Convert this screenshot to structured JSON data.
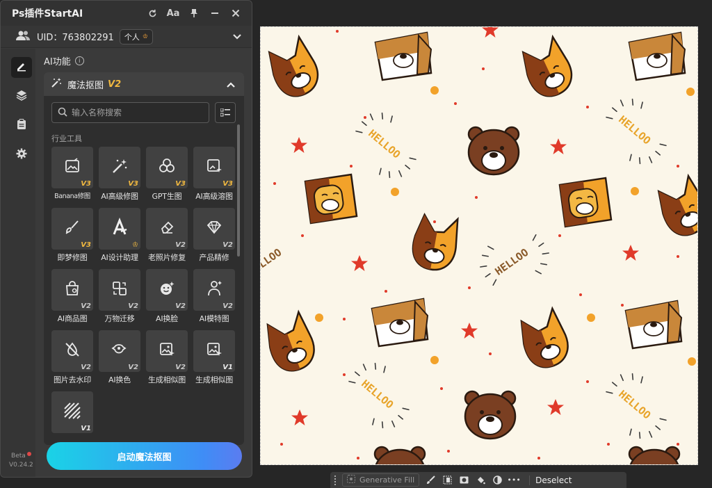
{
  "panel": {
    "title": "Ps插件StartAI",
    "font_button": "Aa",
    "uid_label": "UID：763802291",
    "account_badge": "个人"
  },
  "sidebar": {
    "items": [
      {
        "icon": "pen-icon",
        "active": true
      },
      {
        "icon": "layers-icon",
        "active": false
      },
      {
        "icon": "clipboard-icon",
        "active": false
      },
      {
        "icon": "gear-icon",
        "active": false
      }
    ],
    "beta": "Beta",
    "version": "V0.24.2"
  },
  "section": {
    "title": "AI功能"
  },
  "card": {
    "title": "魔法抠图",
    "version_tag": "V2",
    "search_placeholder": "输入名称搜索",
    "group_label": "行业工具"
  },
  "tools": [
    {
      "label": "Banana修图",
      "version": "V3",
      "icon": "image-edit-icon"
    },
    {
      "label": "AI高级修图",
      "version": "V3",
      "icon": "magic-wand-icon"
    },
    {
      "label": "GPT生图",
      "version": "V3",
      "icon": "gpt-logo-icon"
    },
    {
      "label": "AI高级溶图",
      "version": "V3",
      "icon": "image-sparkle-icon"
    },
    {
      "label": "即梦修图",
      "version": "V3",
      "icon": "brush-icon"
    },
    {
      "label": "AI设计助理",
      "version": "",
      "icon": "design-assistant-icon"
    },
    {
      "label": "老照片修复",
      "version": "V2",
      "icon": "eraser-icon"
    },
    {
      "label": "产品精修",
      "version": "V2",
      "icon": "diamond-icon"
    },
    {
      "label": "AI商品图",
      "version": "V2",
      "icon": "shopping-bag-icon"
    },
    {
      "label": "万物迁移",
      "version": "V2",
      "icon": "transfer-icon"
    },
    {
      "label": "AI换脸",
      "version": "V2",
      "icon": "face-swap-icon"
    },
    {
      "label": "AI模特图",
      "version": "V2",
      "icon": "model-icon"
    },
    {
      "label": "图片去水印",
      "version": "V2",
      "icon": "no-watermark-icon"
    },
    {
      "label": "AI换色",
      "version": "V2",
      "icon": "color-swap-icon"
    },
    {
      "label": "生成相似图",
      "version": "V2",
      "icon": "similar-image-icon"
    },
    {
      "label": "生成相似图",
      "version": "V1",
      "icon": "similar-image-icon"
    },
    {
      "label": "",
      "version": "V1",
      "icon": "texture-icon"
    }
  ],
  "start_button": "启动魔法抠图",
  "bottom_bar": {
    "generative_fill": "Generative Fill",
    "deselect": "Deselect"
  },
  "colors": {
    "accent_gold": "#f0b840",
    "gradient_start": "#1ad3e6",
    "gradient_end": "#5b7cf0",
    "canvas_bg": "#fbf6e9"
  }
}
